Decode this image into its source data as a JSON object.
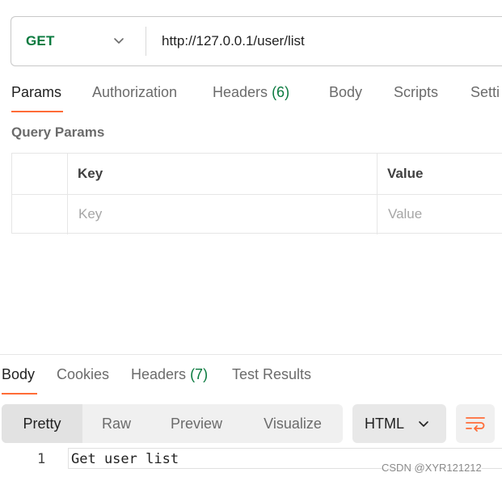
{
  "request": {
    "method": "GET",
    "url": "http://127.0.0.1/user/list"
  },
  "request_tabs": {
    "params": "Params",
    "authorization": "Authorization",
    "headers": "Headers",
    "headers_count": "(6)",
    "body": "Body",
    "scripts": "Scripts",
    "settings": "Setti"
  },
  "query_params": {
    "title": "Query Params",
    "columns": {
      "key": "Key",
      "value": "Value"
    },
    "placeholders": {
      "key": "Key",
      "value": "Value"
    }
  },
  "response_tabs": {
    "body": "Body",
    "cookies": "Cookies",
    "headers": "Headers",
    "headers_count": "(7)",
    "test_results": "Test Results"
  },
  "view_modes": {
    "pretty": "Pretty",
    "raw": "Raw",
    "preview": "Preview",
    "visualize": "Visualize"
  },
  "format": {
    "selected": "HTML"
  },
  "response_body": {
    "line_number": "1",
    "line_text": "Get user list"
  },
  "watermark": "CSDN @XYR121212",
  "colors": {
    "accent": "#ff6c37",
    "method_get": "#0a7a3f",
    "count": "#0a7a3f"
  },
  "icons": {
    "method_dropdown": "chevron-down-icon",
    "format_dropdown": "chevron-down-icon",
    "wrap": "wrap-lines-icon"
  }
}
